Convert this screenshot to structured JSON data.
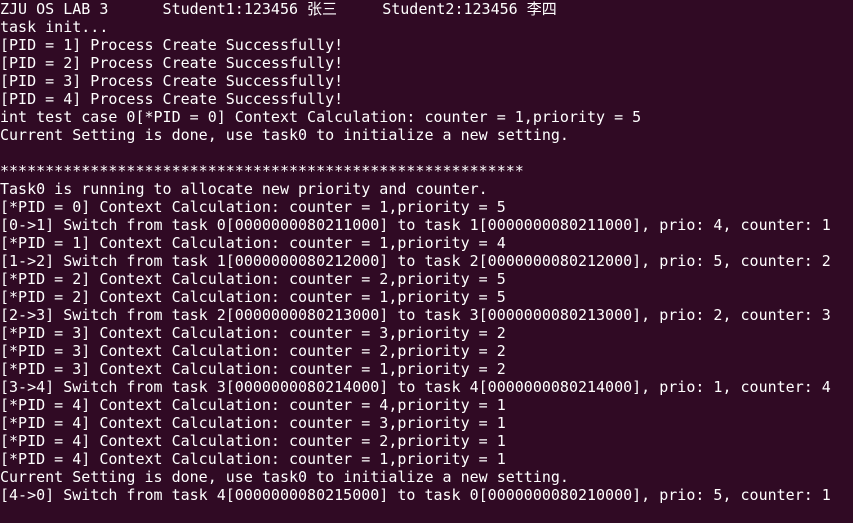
{
  "terminal": {
    "header": "ZJU OS LAB 3      Student1:123456 张三     Student2:123456 李四",
    "lines": [
      "task init...",
      "[PID = 1] Process Create Successfully!",
      "[PID = 2] Process Create Successfully!",
      "[PID = 3] Process Create Successfully!",
      "[PID = 4] Process Create Successfully!",
      "int test case 0[*PID = 0] Context Calculation: counter = 1,priority = 5",
      "Current Setting is done, use task0 to initialize a new setting.",
      "",
      "**********************************************************",
      "Task0 is running to allocate new priority and counter.",
      "[*PID = 0] Context Calculation: counter = 1,priority = 5",
      "[0->1] Switch from task 0[0000000080211000] to task 1[0000000080211000], prio: 4, counter: 1",
      "[*PID = 1] Context Calculation: counter = 1,priority = 4",
      "[1->2] Switch from task 1[0000000080212000] to task 2[0000000080212000], prio: 5, counter: 2",
      "[*PID = 2] Context Calculation: counter = 2,priority = 5",
      "[*PID = 2] Context Calculation: counter = 1,priority = 5",
      "[2->3] Switch from task 2[0000000080213000] to task 3[0000000080213000], prio: 2, counter: 3",
      "[*PID = 3] Context Calculation: counter = 3,priority = 2",
      "[*PID = 3] Context Calculation: counter = 2,priority = 2",
      "[*PID = 3] Context Calculation: counter = 1,priority = 2",
      "[3->4] Switch from task 3[0000000080214000] to task 4[0000000080214000], prio: 1, counter: 4",
      "[*PID = 4] Context Calculation: counter = 4,priority = 1",
      "[*PID = 4] Context Calculation: counter = 3,priority = 1",
      "[*PID = 4] Context Calculation: counter = 2,priority = 1",
      "[*PID = 4] Context Calculation: counter = 1,priority = 1",
      "Current Setting is done, use task0 to initialize a new setting.",
      "[4->0] Switch from task 4[0000000080215000] to task 0[0000000080210000], prio: 5, counter: 1"
    ]
  }
}
